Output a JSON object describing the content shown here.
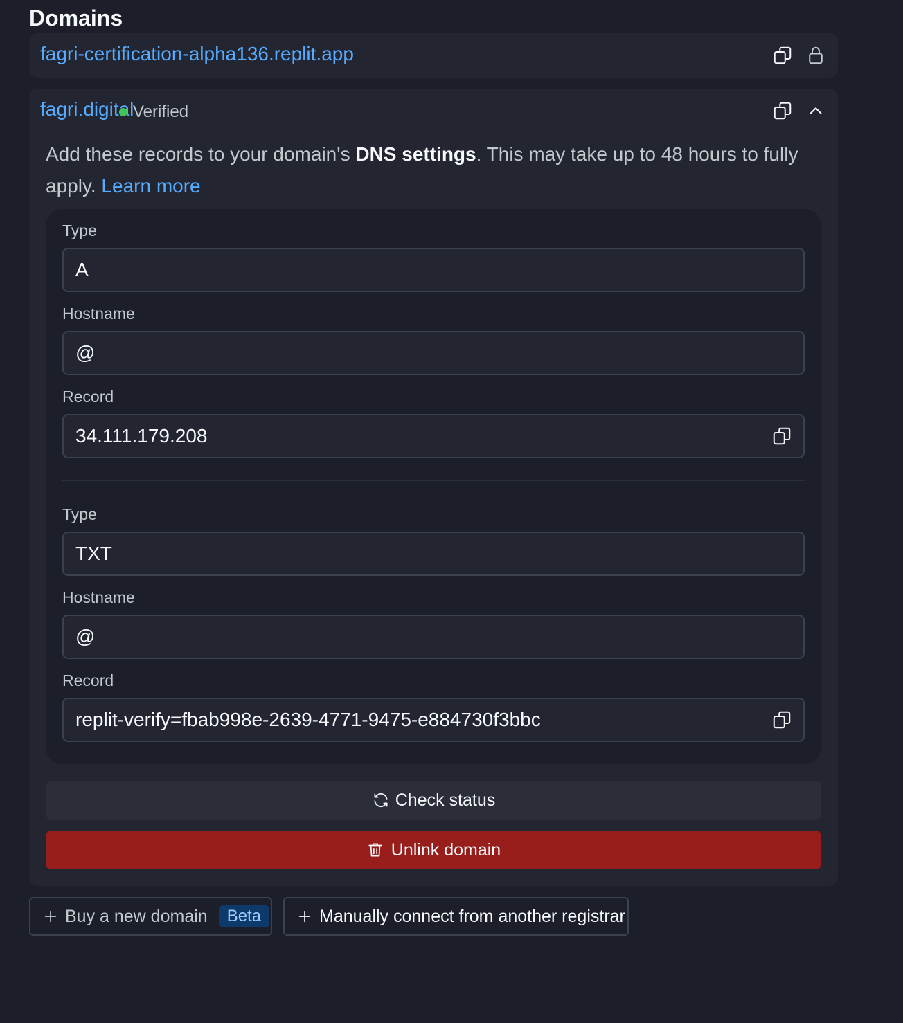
{
  "section": {
    "title": "Domains"
  },
  "domains": [
    {
      "name": "fagri-certification-alpha136.replit.app",
      "copy_icon": "copy-icon",
      "lock_icon": "lock-icon"
    },
    {
      "name": "fagri.digital",
      "status": "Verified",
      "status_color": "#3fc55a",
      "copy_icon": "copy-icon",
      "collapse_icon": "chevron-up-icon",
      "help": {
        "text_before": "Add these records to your domain's ",
        "text_bold": "DNS settings",
        "text_after": ". This may take up to 48 hours to fully apply. ",
        "link_label": "Learn more"
      },
      "records": [
        {
          "type_label": "Type",
          "type_value": "A",
          "hostname_label": "Hostname",
          "hostname_value": "@",
          "record_label": "Record",
          "record_value": "34.111.179.208"
        },
        {
          "type_label": "Type",
          "type_value": "TXT",
          "hostname_label": "Hostname",
          "hostname_value": "@",
          "record_label": "Record",
          "record_value": "replit-verify=fbab998e-2639-4771-9475-e884730f3bbc"
        }
      ],
      "check_status_label": "Check status",
      "unlink_label": "Unlink domain",
      "unlink_color": "#971e1a"
    }
  ],
  "actions": {
    "buy_label": "Buy a new domain",
    "buy_badge": "Beta",
    "manual_label": "Manually connect from another registrar"
  },
  "colors": {
    "background": "#1c1f2a",
    "card": "#232631",
    "link": "#57abff"
  }
}
